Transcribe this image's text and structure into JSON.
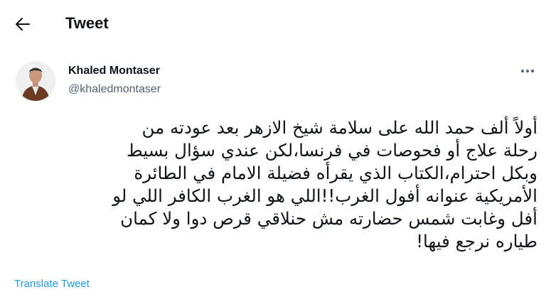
{
  "header": {
    "title": "Tweet",
    "back_icon": "arrow-left-icon"
  },
  "author": {
    "name": "Khaled Montaser",
    "handle": "@khaledmontaser"
  },
  "more_icon": "more-horizontal-icon",
  "tweet": {
    "text": "أولاً ألف حمد الله على سلامة شيخ الازهر بعد عودته من\nرحلة علاج أو فحوصات في فرنسا،لكن عندي سؤال بسيط\nوبكل احترام،الكتاب الذي يقرأه فضيلة الامام في الطائرة\nالأمريكية عنوانه أفول الغرب!!اللي هو الغرب الكافر اللي لو\nأفل وغابت شمس حضارته مش حنلاقي قرص دوا ولا كمان\nطياره نرجع فيها!"
  },
  "translate_label": "Translate Tweet",
  "colors": {
    "text": "#0f1419",
    "secondary": "#536471",
    "link": "#1d9bf0"
  }
}
